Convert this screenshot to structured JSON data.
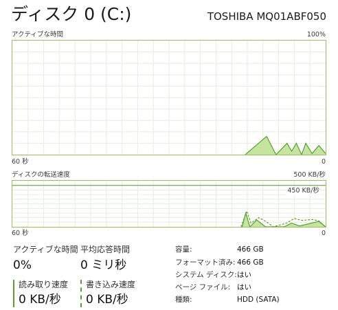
{
  "header": {
    "title": "ディスク 0 (C:)",
    "model": "TOSHIBA MQ01ABF050"
  },
  "active_time_chart": {
    "label": "アクティブな時間",
    "max_label": "100%",
    "x_left_label": "60 秒",
    "x_right_label": "0"
  },
  "transfer_chart": {
    "label": "ディスクの転送速度",
    "max_label": "500 KB/秒",
    "ref_label": "450 KB/秒",
    "x_left_label": "60 秒",
    "x_right_label": "0"
  },
  "chart_data": [
    {
      "type": "area",
      "title": "アクティブな時間",
      "x_unit": "seconds ago",
      "xlim": [
        60,
        0
      ],
      "ylim": [
        0,
        100
      ],
      "series": [
        {
          "values": [
            {
              "x": 15.4,
              "y": 0
            },
            {
              "x": 11.3,
              "y": 16
            },
            {
              "x": 9.5,
              "y": 0
            },
            {
              "x": 7.4,
              "y": 10
            },
            {
              "x": 6.5,
              "y": 3
            },
            {
              "x": 5.6,
              "y": 10
            },
            {
              "x": 4.6,
              "y": 0
            },
            {
              "x": 3.8,
              "y": 10
            },
            {
              "x": 2.6,
              "y": 1
            },
            {
              "x": 1.3,
              "y": 8
            },
            {
              "x": 0,
              "y": 1
            }
          ]
        }
      ]
    },
    {
      "type": "line",
      "title": "ディスクの転送速度",
      "x_unit": "seconds ago",
      "y_unit": "KB/秒",
      "xlim": [
        60,
        0
      ],
      "ylim": [
        0,
        500
      ],
      "reference_line": 450,
      "series": [
        {
          "style": "solid",
          "values": [
            {
              "x": 16.0,
              "y": 0
            },
            {
              "x": 15.3,
              "y": 150
            },
            {
              "x": 14.5,
              "y": 0
            },
            {
              "x": 13.2,
              "y": 75
            },
            {
              "x": 11.5,
              "y": 0
            },
            {
              "x": 8.0,
              "y": 0
            },
            {
              "x": 6.5,
              "y": 40
            },
            {
              "x": 5.0,
              "y": 10
            },
            {
              "x": 1.3,
              "y": 60
            },
            {
              "x": 0,
              "y": 0
            }
          ]
        },
        {
          "style": "dashed",
          "values": [
            {
              "x": 16.2,
              "y": 0
            },
            {
              "x": 15.1,
              "y": 170
            },
            {
              "x": 14.3,
              "y": 40
            },
            {
              "x": 12.8,
              "y": 100
            },
            {
              "x": 11.5,
              "y": 60
            },
            {
              "x": 10.0,
              "y": 0
            },
            {
              "x": 7.5,
              "y": 40
            },
            {
              "x": 6.0,
              "y": 90
            },
            {
              "x": 4.5,
              "y": 70
            },
            {
              "x": 2.5,
              "y": 80
            },
            {
              "x": 1.3,
              "y": 65
            },
            {
              "x": 0,
              "y": 0
            }
          ]
        }
      ]
    }
  ],
  "stats": {
    "active_time": {
      "label": "アクティブな時間",
      "value": "0%"
    },
    "avg_response": {
      "label": "平均応答時間",
      "value": "0 ミリ秒"
    },
    "read_speed": {
      "label": "読み取り速度",
      "value": "0 KB/秒"
    },
    "write_speed": {
      "label": "書き込み速度",
      "value": "0 KB/秒"
    }
  },
  "info": {
    "capacity": {
      "key": "容量:",
      "value": "466 GB"
    },
    "formatted": {
      "key": "フォーマット済み:",
      "value": "466 GB"
    },
    "system_disk": {
      "key": "システム ディスク:",
      "value": "はい"
    },
    "page_file": {
      "key": "ページ ファイル:",
      "value": "はい"
    },
    "type": {
      "key": "種類:",
      "value": "HDD (SATA)"
    }
  },
  "colors": {
    "border": "#97c45a",
    "line": "#5a9e2f",
    "fill": "#c6e3a0",
    "grid": "#e6eedc"
  }
}
